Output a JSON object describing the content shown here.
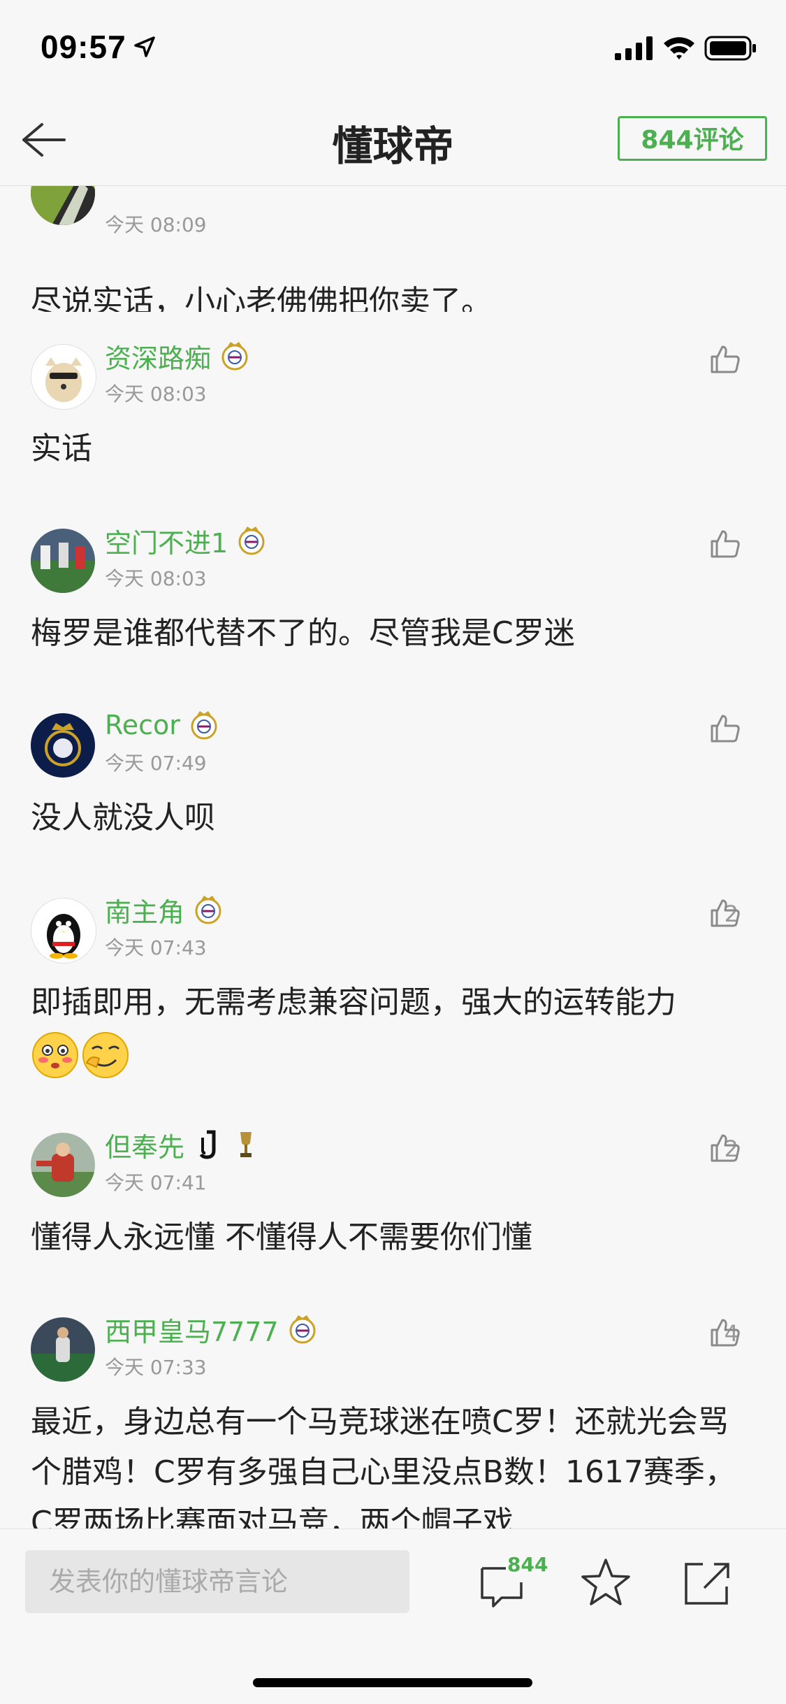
{
  "status": {
    "time": "09:57"
  },
  "nav": {
    "title": "懂球帝",
    "comment_count_label": "844评论"
  },
  "comments": [
    {
      "user": "",
      "time": "今天 08:09",
      "likes": "",
      "text": "尽说实话，小心老佛佛把你卖了。",
      "badges": []
    },
    {
      "user": "资深路痴",
      "time": "今天 08:03",
      "likes": "",
      "text": "实话",
      "badges": [
        "real-madrid-badge"
      ]
    },
    {
      "user": "空门不进1",
      "time": "今天 08:03",
      "likes": "",
      "text": "梅罗是谁都代替不了的。尽管我是C罗迷",
      "badges": [
        "real-madrid-badge"
      ]
    },
    {
      "user": "Recor",
      "time": "今天 07:49",
      "likes": "",
      "text": "没人就没人呗",
      "badges": [
        "real-madrid-badge"
      ]
    },
    {
      "user": "南主角",
      "time": "今天 07:43",
      "likes": "2",
      "text": "即插即用，无需考虑兼容问题，强大的运转能力",
      "badges": [
        "real-madrid-badge"
      ]
    },
    {
      "user": "但奉先",
      "time": "今天 07:41",
      "likes": "2",
      "text": "懂得人永远懂 不懂得人不需要你们懂",
      "badges": [
        "juventus-badge",
        "trophy-badge"
      ]
    },
    {
      "user": "西甲皇马7777",
      "time": "今天 07:33",
      "likes": "4",
      "text": "最近，身边总有一个马竞球迷在喷C罗！还就光会骂个腊鸡！C罗有多强自己心里没点B数！1617赛季，C罗两场比赛面对马竞，两个帽子戏",
      "badges": [
        "real-madrid-badge"
      ]
    }
  ],
  "bottom": {
    "placeholder": "发表你的懂球帝言论",
    "comment_count": "844"
  },
  "colors": {
    "accent": "#4caf50",
    "text": "#222222",
    "muted": "#999999",
    "background": "#f7f7f7"
  }
}
